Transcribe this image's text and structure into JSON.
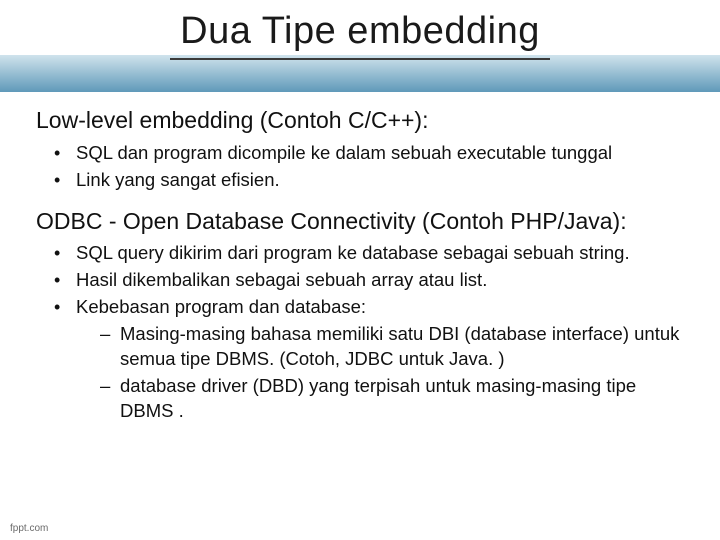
{
  "slide": {
    "title": "Dua Tipe embedding",
    "section1": {
      "heading": "Low-level embedding (Contoh C/C++):",
      "items": [
        "SQL dan program dicompile ke dalam sebuah executable tunggal",
        "Link yang sangat efisien."
      ]
    },
    "section2": {
      "heading": "ODBC - Open Database Connectivity (Contoh PHP/Java):",
      "items": [
        "SQL query dikirim dari program ke database sebagai sebuah string.",
        "Hasil dikembalikan sebagai sebuah array atau list.",
        "Kebebasan program dan database:"
      ],
      "subitems": [
        "Masing-masing bahasa memiliki satu DBI (database interface) untuk semua tipe DBMS. (Cotoh, JDBC untuk Java. )",
        "database driver (DBD) yang terpisah untuk masing-masing tipe DBMS ."
      ]
    },
    "footer": "fppt.com"
  }
}
